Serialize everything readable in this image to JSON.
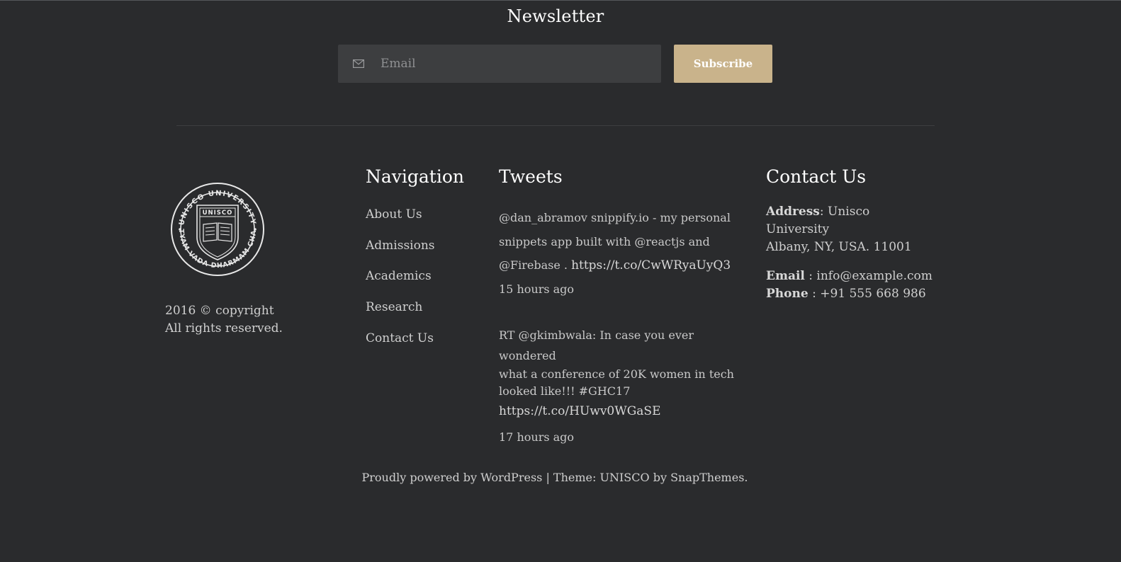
{
  "newsletter": {
    "title": "Newsletter",
    "email_placeholder": "Email",
    "subscribe_label": "Subscribe"
  },
  "brand": {
    "logo_ring_text": "UNISCO UNIVERSITY",
    "logo_bottom_text": "SATYAM VADA DHARMAM CHARA",
    "logo_shield_text": "UNISCO",
    "copyright_line1": "2016 © copyright",
    "copyright_line2": "All rights reserved."
  },
  "navigation": {
    "title": "Navigation",
    "items": [
      "About Us",
      "Admissions",
      "Academics",
      "Research",
      "Contact Us"
    ]
  },
  "tweets": {
    "title": "Tweets",
    "items": [
      {
        "line1": "@dan_abramov snippify.io - my personal",
        "line2": "snippets app built with @reactjs and",
        "line3": "@Firebase .",
        "link": "https://t.co/CwWRyaUyQ3",
        "time": "15 hours ago"
      },
      {
        "line1": "RT @gkimbwala: In case you ever wondered",
        "line2": "what a conference of 20K women in tech",
        "line3": "looked like!!! #GHC17",
        "link": "https://t.co/HUwv0WGaSE",
        "time": "17 hours ago"
      }
    ]
  },
  "contact": {
    "title": "Contact Us",
    "address_label": "Address",
    "address_line1": ": Unisco University",
    "address_line2": "Albany, NY, USA. 11001",
    "email_label": "Email",
    "email_value": " : info@example.com",
    "phone_label": "Phone",
    "phone_value": " : +91 555 668 986"
  },
  "footer": {
    "prefix": "Proudly powered by ",
    "wordpress_link": "WordPress",
    "separator": " | Theme: UNISCO by ",
    "theme_link": "SnapThemes."
  },
  "colors": {
    "background": "#2a2b2d",
    "accent": "#c9b38b",
    "input_bg": "#3d3e40"
  }
}
